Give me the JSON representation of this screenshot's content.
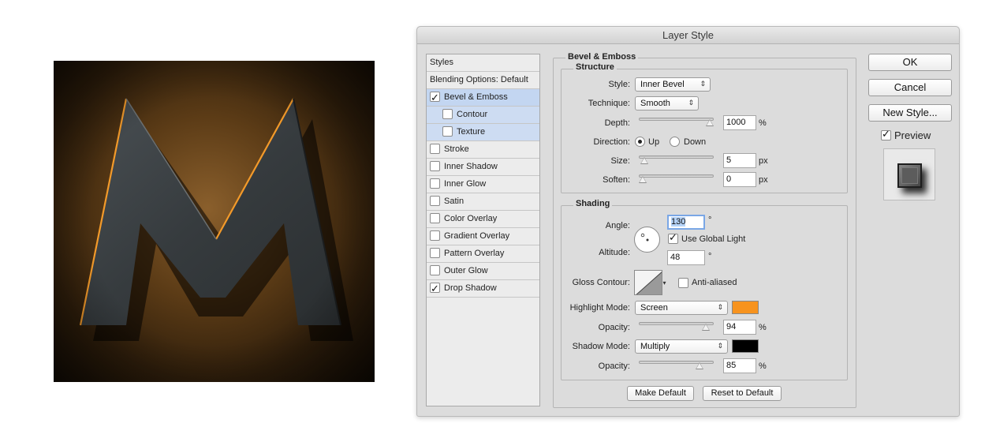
{
  "window": {
    "title": "Layer Style"
  },
  "styles_panel": {
    "header": "Styles",
    "blending": "Blending Options: Default",
    "items": [
      {
        "label": "Bevel & Emboss",
        "checked": true
      },
      {
        "label": "Contour",
        "checked": false
      },
      {
        "label": "Texture",
        "checked": false
      },
      {
        "label": "Stroke",
        "checked": false
      },
      {
        "label": "Inner Shadow",
        "checked": false
      },
      {
        "label": "Inner Glow",
        "checked": false
      },
      {
        "label": "Satin",
        "checked": false
      },
      {
        "label": "Color Overlay",
        "checked": false
      },
      {
        "label": "Gradient Overlay",
        "checked": false
      },
      {
        "label": "Pattern Overlay",
        "checked": false
      },
      {
        "label": "Outer Glow",
        "checked": false
      },
      {
        "label": "Drop Shadow",
        "checked": true
      }
    ]
  },
  "bevel": {
    "title": "Bevel & Emboss",
    "structure": {
      "legend": "Structure",
      "style_label": "Style:",
      "style_value": "Inner Bevel",
      "technique_label": "Technique:",
      "technique_value": "Smooth",
      "depth_label": "Depth:",
      "depth_value": "1000",
      "depth_unit": "%",
      "depth_fraction": 1.0,
      "direction_label": "Direction:",
      "dir_up": "Up",
      "dir_down": "Down",
      "direction_selected": "Up",
      "size_label": "Size:",
      "size_value": "5",
      "size_unit": "px",
      "size_fraction": 0.02,
      "soften_label": "Soften:",
      "soften_value": "0",
      "soften_unit": "px",
      "soften_fraction": 0.0
    },
    "shading": {
      "legend": "Shading",
      "angle_label": "Angle:",
      "angle_value": "130",
      "angle_unit": "°",
      "use_global": "Use Global Light",
      "use_global_checked": true,
      "altitude_label": "Altitude:",
      "altitude_value": "48",
      "altitude_unit": "°",
      "gloss_label": "Gloss Contour:",
      "anti_aliased": "Anti-aliased",
      "anti_aliased_checked": false,
      "highlight_label": "Highlight Mode:",
      "highlight_value": "Screen",
      "highlight_color": "#f7931e",
      "hl_opacity_label": "Opacity:",
      "hl_opacity_value": "94",
      "hl_opacity_unit": "%",
      "hl_opacity_fraction": 0.94,
      "shadow_label": "Shadow Mode:",
      "shadow_value": "Multiply",
      "shadow_color": "#000000",
      "sh_opacity_label": "Opacity:",
      "sh_opacity_value": "85",
      "sh_opacity_unit": "%",
      "sh_opacity_fraction": 0.85
    },
    "make_default": "Make Default",
    "reset_default": "Reset to Default"
  },
  "actions": {
    "ok": "OK",
    "cancel": "Cancel",
    "new_style": "New Style...",
    "preview": "Preview",
    "preview_checked": true
  }
}
